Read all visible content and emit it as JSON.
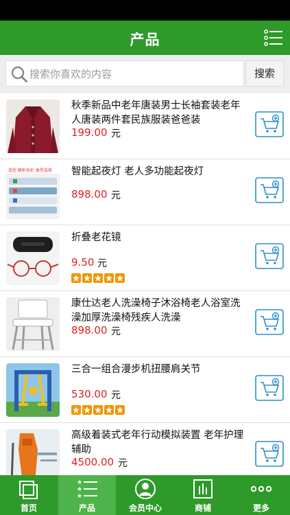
{
  "header": {
    "title": "产品"
  },
  "search": {
    "placeholder": "搜索你喜欢的内容",
    "button_label": "搜索"
  },
  "products": [
    {
      "name": "秋季新品中老年唐装男士长袖套装老年人唐装两件套民族服装爸爸装",
      "price": "199.00",
      "unit": "元",
      "rating": 0
    },
    {
      "name": "智能起夜灯 老人多功能起夜灯",
      "price": "898.00",
      "unit": "元",
      "rating": 0,
      "thumb_text": "造型 解析色彩 类型选择"
    },
    {
      "name": "折叠老花镜",
      "price": "9.50",
      "unit": "元",
      "rating": 5
    },
    {
      "name": "康仕达老人洗澡椅子沐浴椅老人浴室洗澡加厚洗澡椅残疾人洗澡",
      "price": "898.00",
      "unit": "元",
      "rating": 0
    },
    {
      "name": "三合一组合漫步机扭腰肩关节",
      "price": "530.00",
      "unit": "元",
      "rating": 5
    },
    {
      "name": "高级着装式老年行动模拟装置 老年护理辅助",
      "price": "4500.00",
      "unit": "元",
      "rating": 0
    }
  ],
  "tabbar": {
    "tabs": [
      {
        "label": "首页"
      },
      {
        "label": "产品"
      },
      {
        "label": "会员中心"
      },
      {
        "label": "商铺"
      },
      {
        "label": "更多"
      }
    ],
    "active_index": 1
  },
  "colors": {
    "brand_green": "#2e9a2a",
    "tab_active": "#4db34a",
    "price_red": "#e02020",
    "star_orange": "#f29400",
    "cart_blue": "#2a8fc9"
  }
}
